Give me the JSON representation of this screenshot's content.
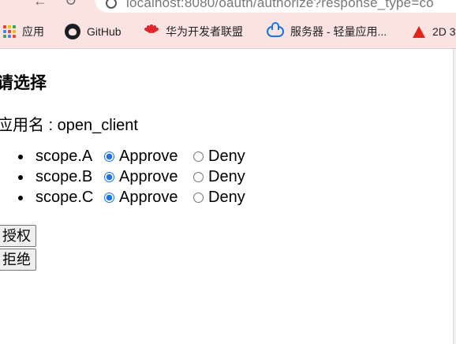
{
  "browser": {
    "url": "localhost:8080/oauth/authorize?response_type=co",
    "bookmarks": [
      {
        "label": "应用",
        "icon": "apps-grid-icon"
      },
      {
        "label": "GitHub",
        "icon": "github-icon"
      },
      {
        "label": "华为开发者联盟",
        "icon": "huawei-icon"
      },
      {
        "label": "服务器 - 轻量应用...",
        "icon": "cloud-icon"
      },
      {
        "label": "2D 3",
        "icon": "adobe-icon"
      }
    ]
  },
  "page": {
    "title": "请选择",
    "app_name_line": "应用名 : open_client",
    "scopes": [
      {
        "name": "scope.A",
        "approve_label": "Approve",
        "deny_label": "Deny",
        "selected": "approve"
      },
      {
        "name": "scope.B",
        "approve_label": "Approve",
        "deny_label": "Deny",
        "selected": "approve"
      },
      {
        "name": "scope.C",
        "approve_label": "Approve",
        "deny_label": "Deny",
        "selected": "approve"
      }
    ],
    "authorize_button": "授权",
    "deny_button": "拒绝"
  },
  "colors": {
    "chrome_bg": "#fbe3e2",
    "radio_accent": "#1a73e8"
  }
}
